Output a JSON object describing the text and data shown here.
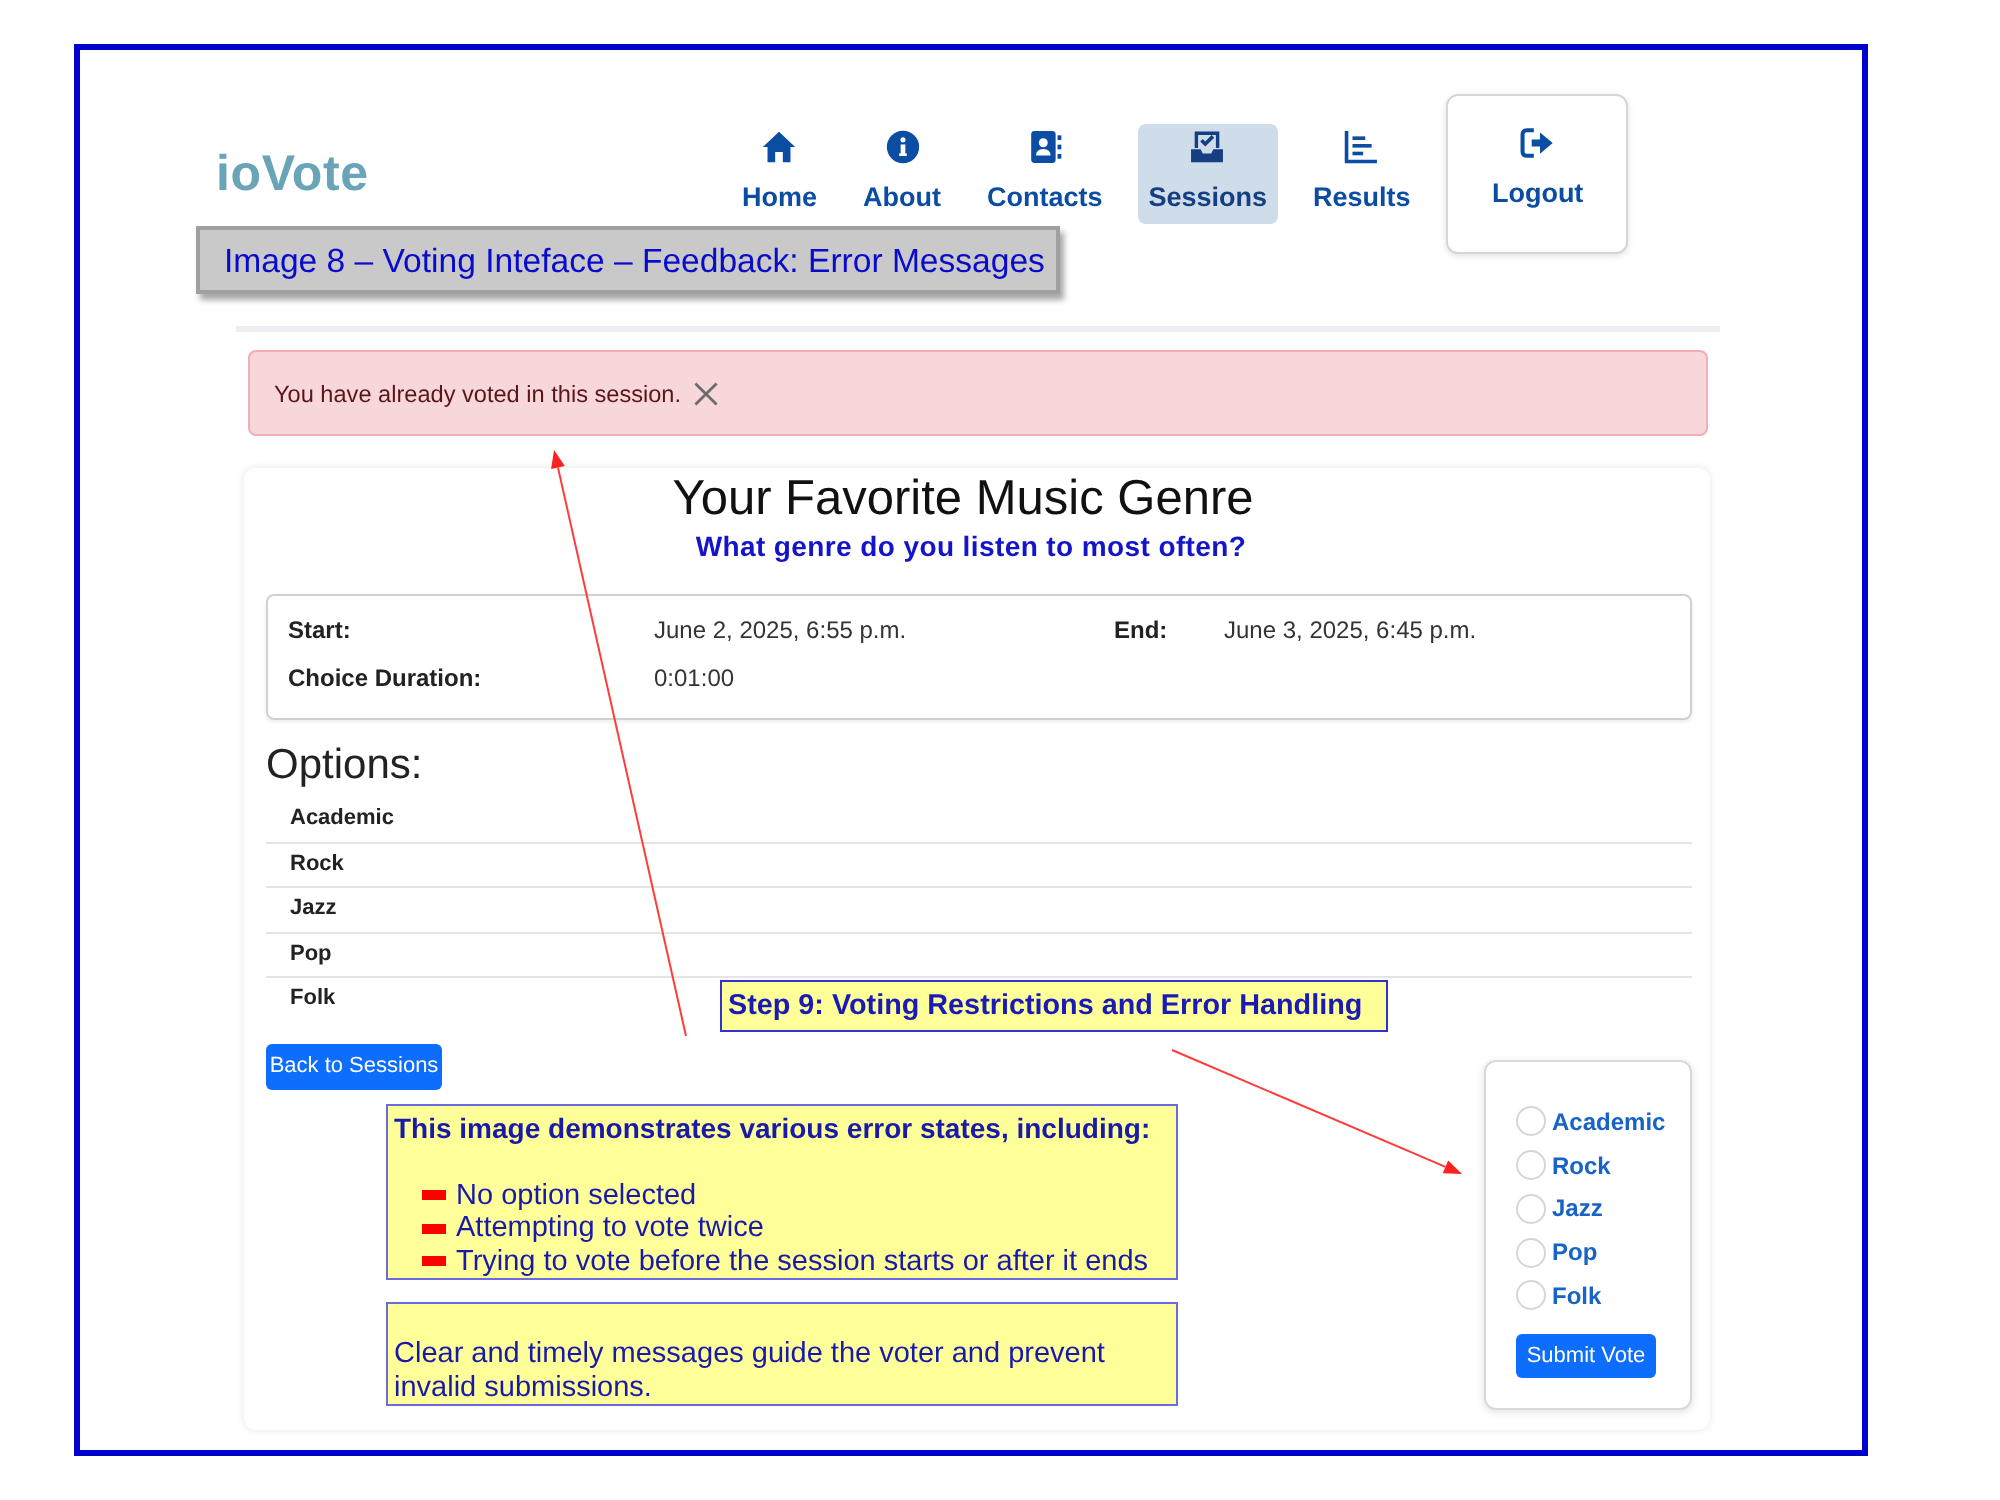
{
  "navbar": {
    "logo": "ioVote",
    "items": [
      {
        "label": "Home",
        "kind": "link",
        "selected": false
      },
      {
        "label": "About",
        "kind": "link",
        "selected": false
      },
      {
        "label": "Contacts",
        "kind": "link",
        "selected": false
      },
      {
        "label": "Sessions",
        "kind": "link",
        "selected": true
      },
      {
        "label": "Results",
        "kind": "link",
        "selected": false
      },
      {
        "label": "Logout",
        "kind": "card",
        "selected": false
      }
    ]
  },
  "alert": {
    "text": "You have already voted in this session."
  },
  "session": {
    "title": "Your Favorite Music Genre",
    "question": "What genre do you listen to most often?",
    "details": [
      {
        "label": "Start:",
        "value": "June 2, 2025, 6:55 p.m."
      },
      {
        "label": "End:",
        "value": "June 3, 2025, 6:45 p.m."
      },
      {
        "label": "Choice Duration:",
        "value": "0:01:00"
      }
    ],
    "options_heading": "Options:",
    "options": [
      "Academic",
      "Rock",
      "Jazz",
      "Pop",
      "Folk"
    ],
    "back_button": "Back to Sessions"
  },
  "vote_form": {
    "options": [
      {
        "label": "Academic",
        "selected": false
      },
      {
        "label": "Rock",
        "selected": false
      },
      {
        "label": "Jazz",
        "selected": false
      },
      {
        "label": "Pop",
        "selected": false
      },
      {
        "label": "Folk",
        "selected": false
      }
    ],
    "submit_button": "Submit Vote"
  },
  "annotations": {
    "caption": "Image 8 – Voting Inteface – Feedback: Error Messages",
    "step": "Step 9: Voting Restrictions and Error Handling",
    "notes": [
      {
        "kind": "list",
        "heading": "This image demonstrates various error states, including:",
        "items": [
          "No option selected",
          "Attempting to vote twice",
          "Trying to vote before the session starts or after it ends"
        ]
      },
      {
        "kind": "text",
        "text": "Clear and timely messages guide the voter and prevent invalid submissions."
      }
    ]
  }
}
